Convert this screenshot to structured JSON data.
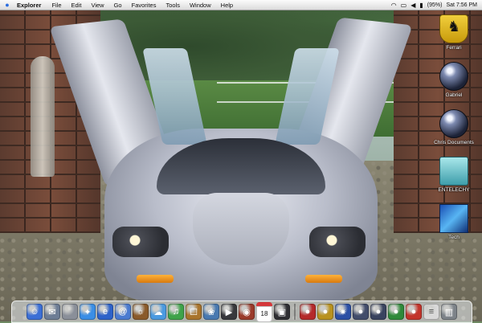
{
  "menubar": {
    "apple_icon": "apple-icon",
    "app_name": "Explorer",
    "menus": [
      "File",
      "Edit",
      "View",
      "Go",
      "Favorites",
      "Tools",
      "Window",
      "Help"
    ],
    "battery_text": "(95%)",
    "clock": "Sat 7:56 PM"
  },
  "desktop": {
    "icons": [
      {
        "label": "Ferrari",
        "icon": "ferrari-icon"
      },
      {
        "label": "Gabriel",
        "icon": "disk-orb-icon"
      },
      {
        "label": "Chris Documents",
        "icon": "disk-orb-icon"
      },
      {
        "label": "ENTELECHY",
        "icon": "folder-box-icon"
      },
      {
        "label": "Tech",
        "icon": "tech-folder-icon"
      }
    ]
  },
  "dock": {
    "items": [
      {
        "name": "finder-icon",
        "color": "#3b6fd6",
        "glyph": "☺"
      },
      {
        "name": "mail-icon",
        "color": "#6d7d95",
        "glyph": "✉"
      },
      {
        "name": "system-prefs-icon",
        "color": "#8a8f99",
        "glyph": ""
      },
      {
        "name": "safari-icon",
        "color": "#3a8ee6",
        "glyph": "✦"
      },
      {
        "name": "internet-explorer-icon",
        "color": "#2d62c9",
        "glyph": "e"
      },
      {
        "name": "address-book-icon",
        "color": "#4b7bd0",
        "glyph": "@"
      },
      {
        "name": "sherlock-icon",
        "color": "#8a5a2a",
        "glyph": "☼"
      },
      {
        "name": "ichat-icon",
        "color": "#4a9ae0",
        "glyph": "☁"
      },
      {
        "name": "itunes-icon",
        "color": "#3fa34a",
        "glyph": "♫"
      },
      {
        "name": "ibook-icon",
        "color": "#a9742c",
        "glyph": "☐"
      },
      {
        "name": "iphoto-icon",
        "color": "#4979b0",
        "glyph": "❀"
      },
      {
        "name": "imovie-icon",
        "color": "#37383c",
        "glyph": "▶"
      },
      {
        "name": "dvd-player-icon",
        "color": "#9a3a2a",
        "glyph": "◉"
      },
      {
        "name": "ical-icon",
        "color": "#d5373a",
        "glyph": "18"
      },
      {
        "name": "photo-icon",
        "color": "#2f2f33",
        "glyph": "▣"
      },
      {
        "name": "separator",
        "color": "",
        "glyph": ""
      },
      {
        "name": "red-ball-icon",
        "color": "#b52a2a",
        "glyph": "●"
      },
      {
        "name": "gold-ball-icon",
        "color": "#b9921f",
        "glyph": "●"
      },
      {
        "name": "blue-star-icon",
        "color": "#2b4fa5",
        "glyph": "✷"
      },
      {
        "name": "orb-icon",
        "color": "#424d6b",
        "glyph": "●"
      },
      {
        "name": "orb-icon",
        "color": "#39435f",
        "glyph": "●"
      },
      {
        "name": "green-ball-icon",
        "color": "#2f8a3a",
        "glyph": "●"
      },
      {
        "name": "apple-ball-icon",
        "color": "#c3342b",
        "glyph": "●"
      },
      {
        "name": "document-icon",
        "color": "#d9d9d9",
        "glyph": "≡"
      },
      {
        "name": "trash-icon",
        "color": "#7d8389",
        "glyph": "▥"
      }
    ]
  },
  "colors": {
    "menubar_bg": "#ececec",
    "accent": "#2a6de0"
  }
}
